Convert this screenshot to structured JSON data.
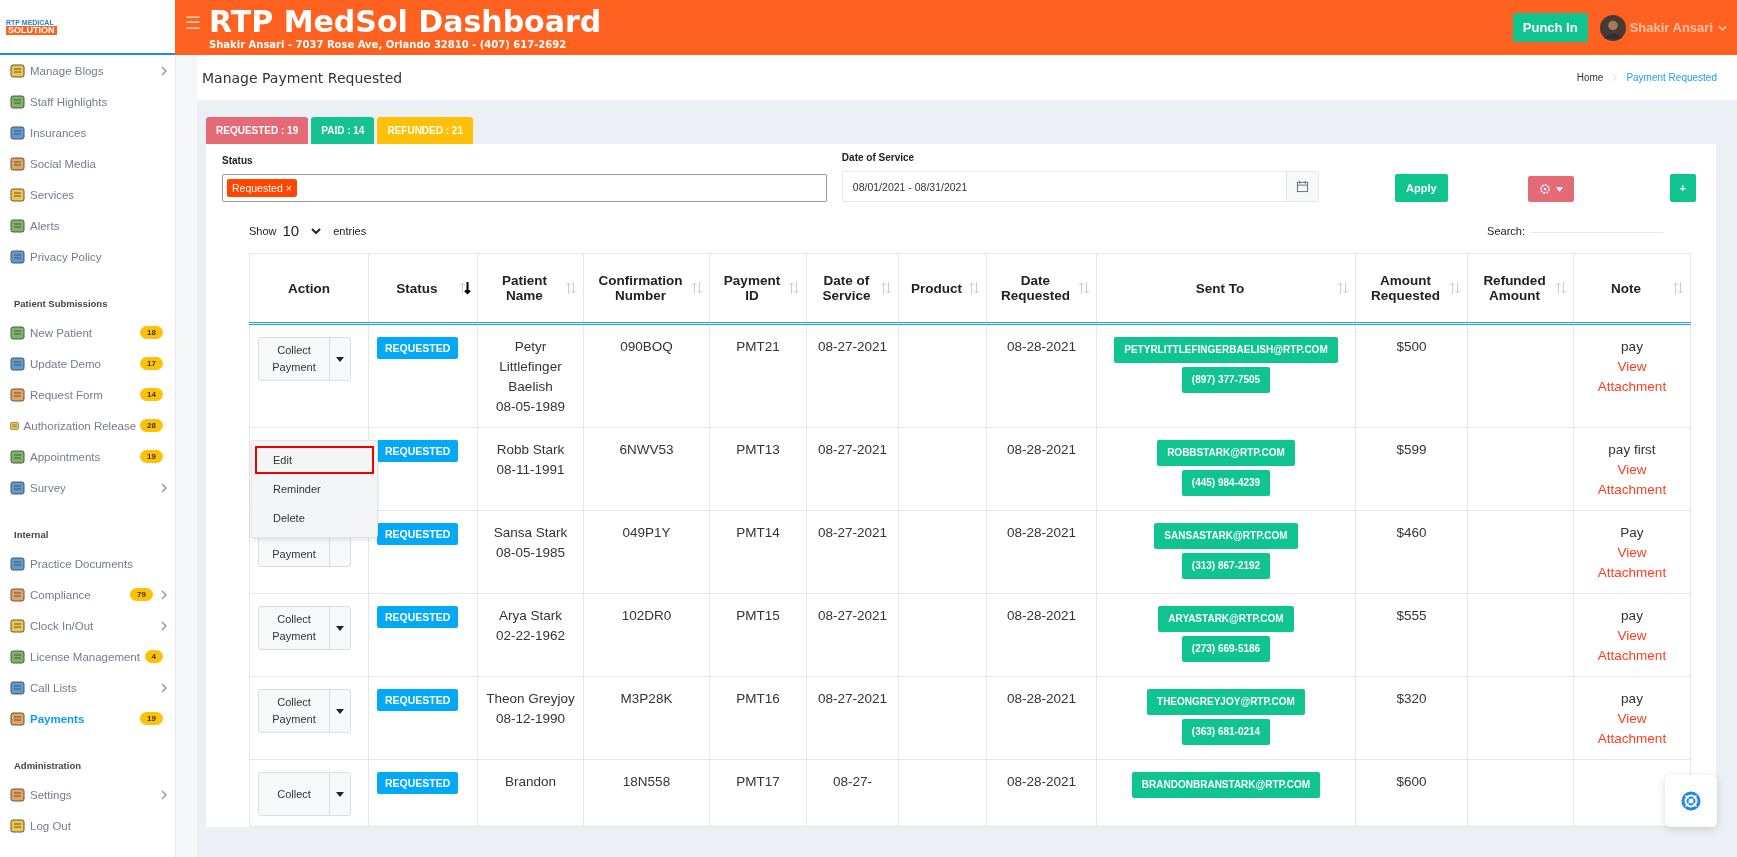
{
  "logo": {
    "line1": "RTP MEDICAL",
    "line2": "SOLUTION"
  },
  "header": {
    "menu_icon": "☰",
    "title": "RTP MedSol Dashboard",
    "subtitle": "Shakir Ansari - 7037 Rose Ave, Orlando 32810 - (407) 617-2692",
    "punch_button": "Punch In",
    "user_name": "Shakir Ansari"
  },
  "sidebar": {
    "sections": [
      {
        "items": [
          {
            "label": "Manage Blogs",
            "has_children": true,
            "selected": false
          },
          {
            "label": "Staff Highlights",
            "has_children": false,
            "selected": false
          },
          {
            "label": "Insurances",
            "has_children": false,
            "selected": false
          },
          {
            "label": "Social Media",
            "has_children": false,
            "selected": false
          },
          {
            "label": "Services",
            "has_children": false,
            "selected": false
          },
          {
            "label": "Alerts",
            "has_children": false,
            "selected": false
          },
          {
            "label": "Privacy Policy",
            "has_children": false,
            "selected": false
          }
        ]
      },
      {
        "heading": "Patient Submissions",
        "items": [
          {
            "label": "New Patient",
            "badge": "18",
            "has_children": false,
            "selected": false
          },
          {
            "label": "Update Demo",
            "badge": "17",
            "has_children": false,
            "selected": false
          },
          {
            "label": "Request Form",
            "badge": "14",
            "has_children": false,
            "selected": false
          },
          {
            "label": "Authorization Release",
            "badge": "28",
            "has_children": false,
            "selected": false
          },
          {
            "label": "Appointments",
            "badge": "19",
            "has_children": false,
            "selected": false
          },
          {
            "label": "Survey",
            "has_children": true,
            "selected": false
          }
        ]
      },
      {
        "heading": "Internal",
        "items": [
          {
            "label": "Practice Documents",
            "has_children": false,
            "selected": false
          },
          {
            "label": "Compliance",
            "badge": "79",
            "has_children": true,
            "selected": false
          },
          {
            "label": "Clock In/Out",
            "has_children": true,
            "selected": false
          },
          {
            "label": "License Management",
            "badge": "4",
            "has_children": false,
            "selected": false
          },
          {
            "label": "Call Lists",
            "has_children": true,
            "selected": false
          },
          {
            "label": "Payments",
            "badge": "19",
            "has_children": false,
            "selected": true
          }
        ]
      },
      {
        "heading": "Administration",
        "items": [
          {
            "label": "Settings",
            "has_children": true,
            "selected": false
          },
          {
            "label": "Log Out",
            "has_children": false,
            "selected": false
          }
        ]
      }
    ]
  },
  "page": {
    "title": "Manage Payment Requested",
    "breadcrumb": [
      {
        "label": "Home",
        "selected": false
      },
      {
        "label": "Payment Requested",
        "selected": true
      }
    ]
  },
  "counters": [
    {
      "label": "REQUESTED : 19",
      "color": "#e46a76"
    },
    {
      "label": "PAID : 14",
      "color": "#16c28f"
    },
    {
      "label": "REFUNDED : 21",
      "color": "#ffc107"
    }
  ],
  "filters": {
    "status_label": "Status",
    "status_tags": [
      "Requested ×"
    ],
    "date_label": "Date of Service",
    "date_value": "08/01/2021 - 08/31/2021",
    "apply_button": "Apply",
    "add_button": "+"
  },
  "table_controls": {
    "show_label": "Show",
    "page_size": "10",
    "entries_label": "entries",
    "search_label": "Search:"
  },
  "table": {
    "columns": [
      {
        "label": "Action",
        "sortable": false
      },
      {
        "label": "Status",
        "sortable": true,
        "sorted": true
      },
      {
        "label": "Patient Name",
        "sortable": true,
        "sorted": false
      },
      {
        "label": "Confirmation Number",
        "sortable": true,
        "sorted": false
      },
      {
        "label": "Payment ID",
        "sortable": true,
        "sorted": false
      },
      {
        "label": "Date of Service",
        "sortable": true,
        "sorted": false
      },
      {
        "label": "Product",
        "sortable": true,
        "sorted": false
      },
      {
        "label": "Date Requested",
        "sortable": true,
        "sorted": false
      },
      {
        "label": "Sent To",
        "sortable": true,
        "sorted": false
      },
      {
        "label": "Amount Requested",
        "sortable": true,
        "sorted": false
      },
      {
        "label": "Refunded Amount",
        "sortable": true,
        "sorted": false
      },
      {
        "label": "Note",
        "sortable": true,
        "sorted": false
      }
    ],
    "rows": [
      {
        "kind": "full",
        "action": "Collect Payment",
        "menu_open": false,
        "status": "REQUESTED",
        "patient": "Petyr Littlefinger Baelish",
        "dob": "08-05-1989",
        "confirmation": "090BOQ",
        "payment_id": "PMT21",
        "date_of_service": "08-27-2021",
        "date_requested": "08-28-2021",
        "email": "PETYRLITTLEFINGERBAELISH@RTP.COM",
        "phone": "(897) 377-7505",
        "amount": "$500",
        "note": "pay",
        "attachment": "View Attachment"
      },
      {
        "kind": "hidden",
        "menu_open": true,
        "status": "REQUESTED",
        "patient": "Robb Stark",
        "dob": "08-11-1991",
        "confirmation": "6NWV53",
        "payment_id": "PMT13",
        "date_of_service": "08-27-2021",
        "date_requested": "08-28-2021",
        "email": "ROBBSTARK@RTP.COM",
        "phone": "(445) 984-4239",
        "amount": "$599",
        "note": "pay first",
        "attachment": "View Attachment"
      },
      {
        "kind": "partial",
        "action": "Payment",
        "menu_open": false,
        "status": "REQUESTED",
        "patient": "Sansa Stark",
        "dob": "08-05-1985",
        "confirmation": "049P1Y",
        "payment_id": "PMT14",
        "date_of_service": "08-27-2021",
        "date_requested": "08-28-2021",
        "email": "SANSASTARK@RTP.COM",
        "phone": "(313) 867-2192",
        "amount": "$460",
        "note": "Pay",
        "attachment": "View Attachment"
      },
      {
        "kind": "full",
        "action": "Collect Payment",
        "menu_open": false,
        "status": "REQUESTED",
        "patient": "Arya Stark",
        "dob": "02-22-1962",
        "confirmation": "102DR0",
        "payment_id": "PMT15",
        "date_of_service": "08-27-2021",
        "date_requested": "08-28-2021",
        "email": "ARYASTARK@RTP.COM",
        "phone": "(273) 669-5186",
        "amount": "$555",
        "note": "pay",
        "attachment": "View Attachment"
      },
      {
        "kind": "full",
        "action": "Collect Payment",
        "menu_open": false,
        "status": "REQUESTED",
        "patient": "Theon Greyjoy",
        "dob": "08-12-1990",
        "confirmation": "M3P28K",
        "payment_id": "PMT16",
        "date_of_service": "08-27-2021",
        "date_requested": "08-28-2021",
        "email": "THEONGREYJOY@RTP.COM",
        "phone": "(363) 681-0214",
        "amount": "$320",
        "note": "pay",
        "attachment": "View Attachment"
      },
      {
        "kind": "full",
        "action": "Collect",
        "menu_open": false,
        "status": "REQUESTED",
        "patient": "Brandon",
        "confirmation": "18N558",
        "payment_id": "PMT17",
        "date_of_service": "08-27-",
        "date_requested": "08-28-2021",
        "email": "BRANDONBRANSTARK@RTP.COM",
        "amount": "$600"
      }
    ]
  },
  "action_menu": [
    {
      "label": "Edit",
      "highlighted": true
    },
    {
      "label": "Reminder",
      "highlighted": false
    },
    {
      "label": "Delete",
      "highlighted": false
    }
  ]
}
